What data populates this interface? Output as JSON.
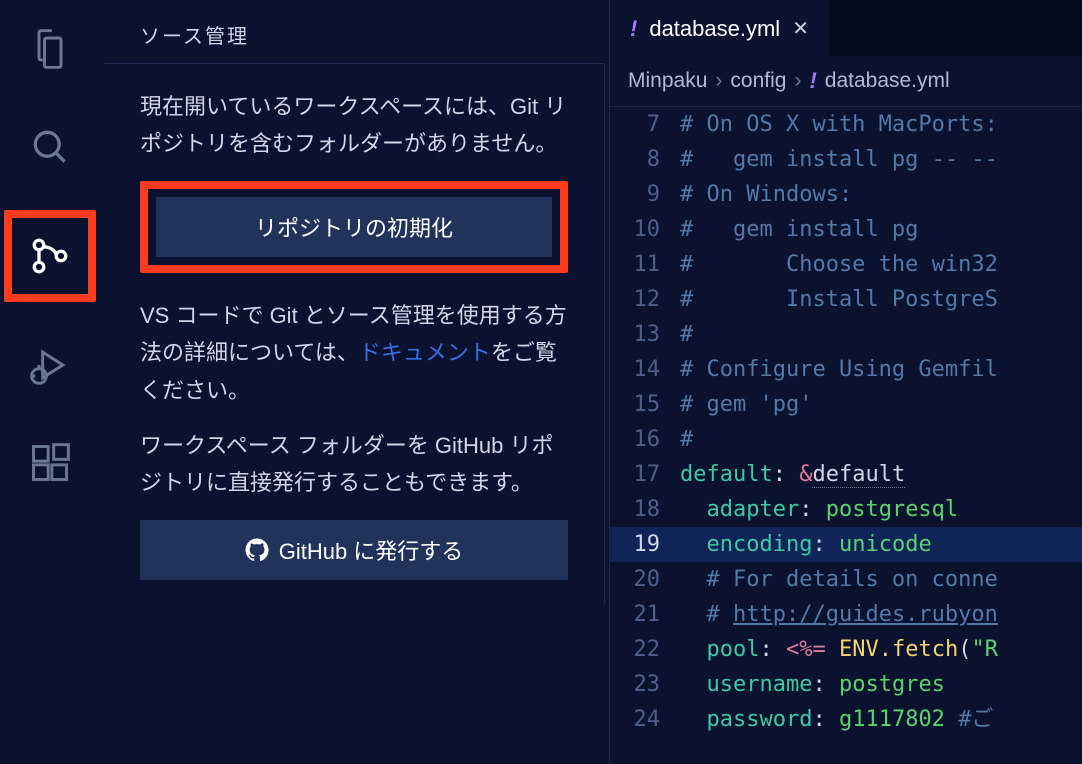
{
  "sidebar": {
    "title": "ソース管理",
    "desc1": "現在開いているワークスペースには、Git リポジトリを含むフォルダーがありません。",
    "init_btn": "リポジトリの初期化",
    "desc2_a": "VS コードで Git とソース管理を使用する方法の詳細については、",
    "desc2_link": "ドキュメント",
    "desc2_b": "をご覧ください。",
    "desc3": "ワークスペース フォルダーを GitHub リポジトリに直接発行することもできます。",
    "github_btn": "GitHub に発行する"
  },
  "tab": {
    "filename": "database.yml"
  },
  "breadcrumb": {
    "p0": "Minpaku",
    "p1": "config",
    "p2": "database.yml"
  },
  "code": [
    {
      "n": 7,
      "cls": "",
      "html": "<span class='cm'># On OS X with MacPorts:</span>"
    },
    {
      "n": 8,
      "cls": "",
      "html": "<span class='cm'>#   gem install pg -- --</span>"
    },
    {
      "n": 9,
      "cls": "",
      "html": "<span class='cm'># On Windows:</span>"
    },
    {
      "n": 10,
      "cls": "",
      "html": "<span class='cm'>#   gem install pg</span>"
    },
    {
      "n": 11,
      "cls": "",
      "html": "<span class='cm'>#       Choose the win32</span>"
    },
    {
      "n": 12,
      "cls": "",
      "html": "<span class='cm'>#       Install PostgreS</span>"
    },
    {
      "n": 13,
      "cls": "",
      "html": "<span class='cm'>#</span>"
    },
    {
      "n": 14,
      "cls": "",
      "html": "<span class='cm'># Configure Using Gemfil</span>"
    },
    {
      "n": 15,
      "cls": "",
      "html": "<span class='cm'># gem 'pg'</span>"
    },
    {
      "n": 16,
      "cls": "",
      "html": "<span class='cm'>#</span>"
    },
    {
      "n": 17,
      "cls": "",
      "html": "<span class='key'>default</span>: <span class='tag'>&amp;</span><span class='anchor'>default</span>"
    },
    {
      "n": 18,
      "cls": "",
      "html": "  <span class='key'>adapter</span>: <span class='str'>postgresql</span>"
    },
    {
      "n": 19,
      "cls": "row-current",
      "html": "  <span class='key'>encoding</span>: <span class='str'>unicode</span>"
    },
    {
      "n": 20,
      "cls": "",
      "html": "  <span class='cm'># For details on conne</span>"
    },
    {
      "n": 21,
      "cls": "",
      "html": "  <span class='cm'># </span><span class='url'>http://guides.rubyon</span>"
    },
    {
      "n": 22,
      "cls": "",
      "html": "  <span class='key'>pool</span>: <span class='tag'>&lt;%=</span> <span class='func'>ENV.fetch</span>(<span class='str'>\"R</span>"
    },
    {
      "n": 23,
      "cls": "",
      "html": "  <span class='key'>username</span>: <span class='str'>postgres</span>"
    },
    {
      "n": 24,
      "cls": "",
      "html": "  <span class='key'>password</span>: <span class='str'>g1117802</span> <span class='cm'>#ご</span>"
    }
  ]
}
